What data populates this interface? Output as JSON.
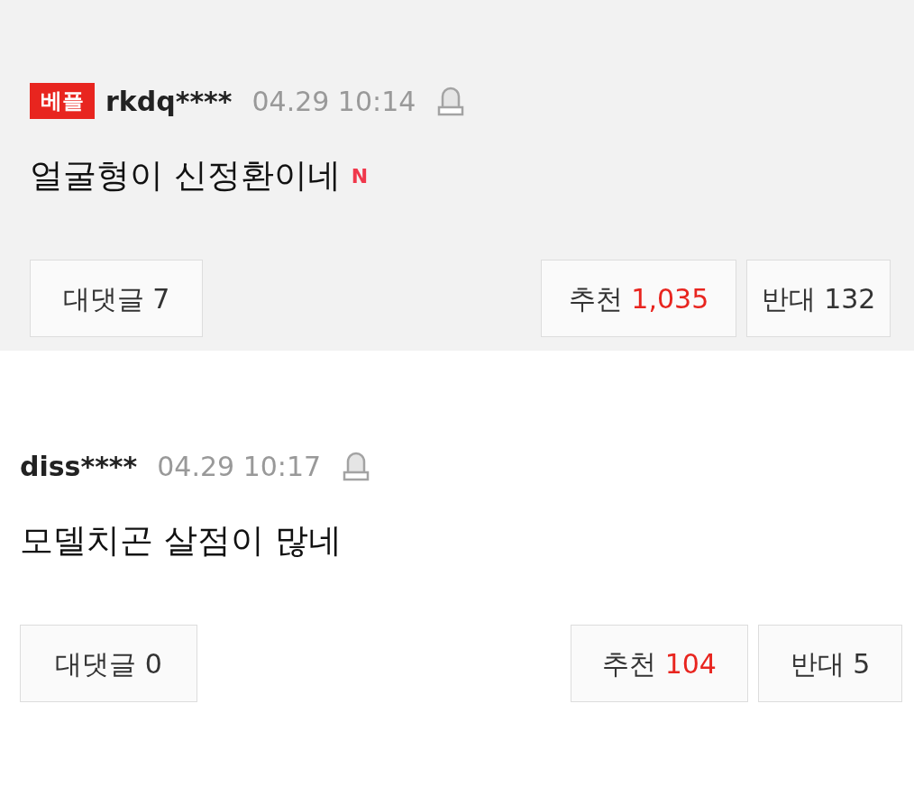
{
  "comments": [
    {
      "highlighted": true,
      "badge": "베플",
      "user": "rkdq****",
      "time": "04.29 10:14",
      "text": "얼굴형이 신정환이네",
      "new_mark": "N",
      "reply_button": "대댓글 7",
      "like_label": "추천",
      "like_count": "1,035",
      "dislike_label": "반대",
      "dislike_count": "132"
    },
    {
      "highlighted": false,
      "user": "diss****",
      "time": "04.29 10:17",
      "text": "모델치곤 살점이 많네",
      "reply_button": "대댓글 0",
      "like_label": "추천",
      "like_count": "104",
      "dislike_label": "반대",
      "dislike_count": "5"
    }
  ]
}
